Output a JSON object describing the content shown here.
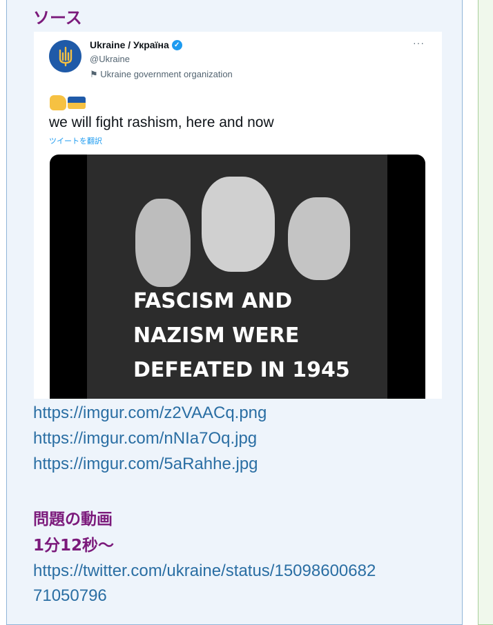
{
  "heading_source": "ソース",
  "tweet": {
    "name": "Ukraine / Україна",
    "handle": "@Ukraine",
    "org_label": "Ukraine government organization",
    "more": "···",
    "text": "we will fight rashism, here and now",
    "translate": "ツイートを翻訳",
    "image_text": [
      "FASCISM AND",
      "NAZISM WERE",
      "DEFEATED IN 1945"
    ]
  },
  "links": [
    "https://imgur.com/z2VAACq.png",
    "https://imgur.com/nNIa7Oq.jpg",
    "https://imgur.com/5aRahhe.jpg"
  ],
  "heading_video": "問題の動画",
  "heading_time": "1分12秒〜",
  "video_link": [
    "https://twitter.com/ukraine/status/15098600682",
    "71050796"
  ],
  "colors": {
    "heading": "#7b1a7b",
    "link": "#2a6ea3",
    "panel_bg": "#eef4fb",
    "panel_border": "#8fb4d8",
    "twitter_blue": "#1d9bf0",
    "flag_blue": "#1f5aa8",
    "flag_yellow": "#f6c142"
  }
}
